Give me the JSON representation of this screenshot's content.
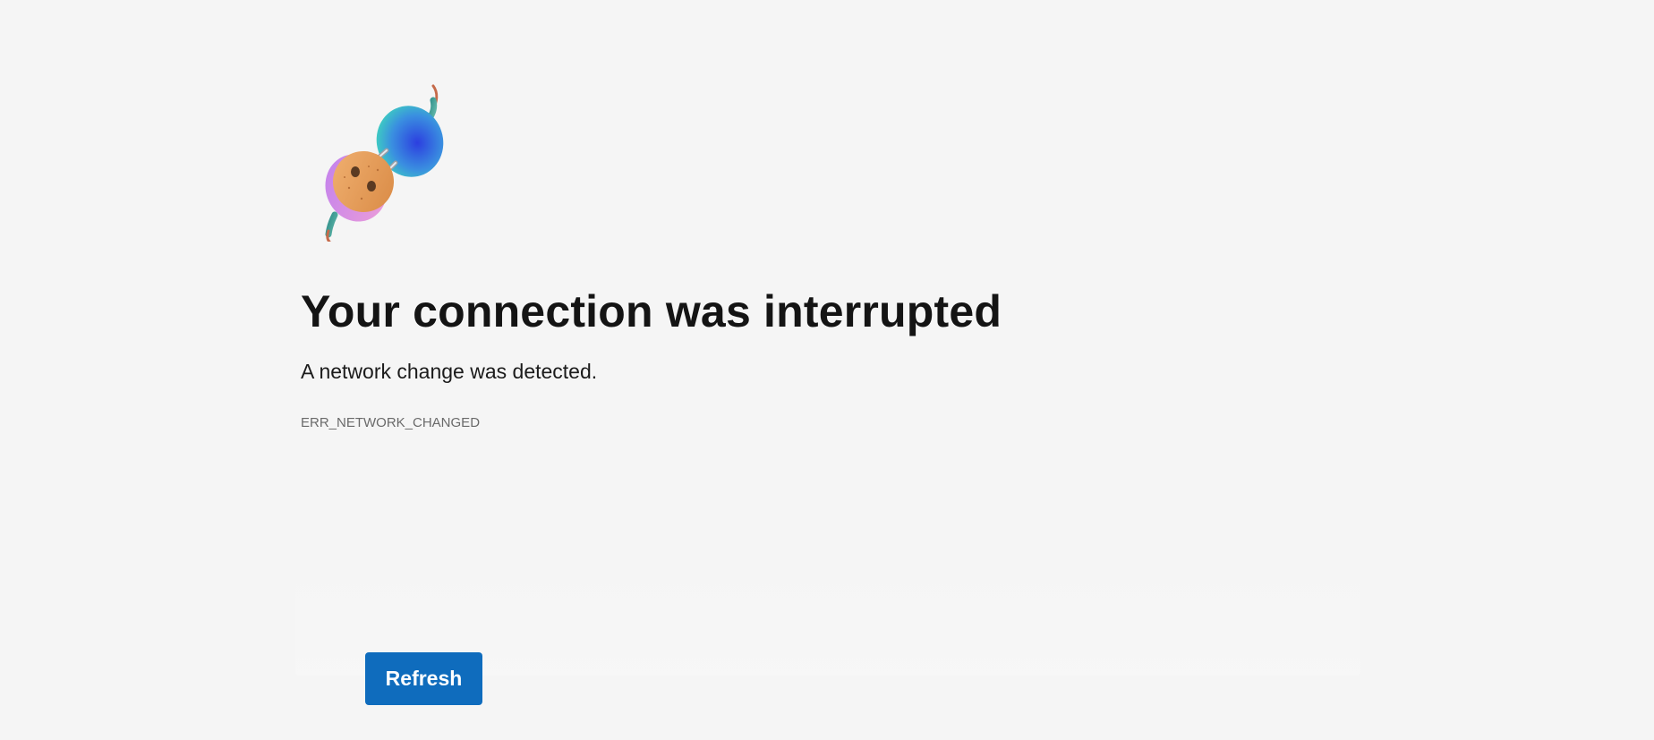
{
  "error_page": {
    "title": "Your connection was interrupted",
    "subtitle": "A network change was detected.",
    "error_code": "ERR_NETWORK_CHANGED",
    "refresh_label": "Refresh"
  },
  "illustration": {
    "icon": "unplugged-plug-icon"
  },
  "colors": {
    "background": "#f5f5f5",
    "accent": "#0f6cbd",
    "title": "#141414",
    "error_code": "#6a6a6a"
  }
}
